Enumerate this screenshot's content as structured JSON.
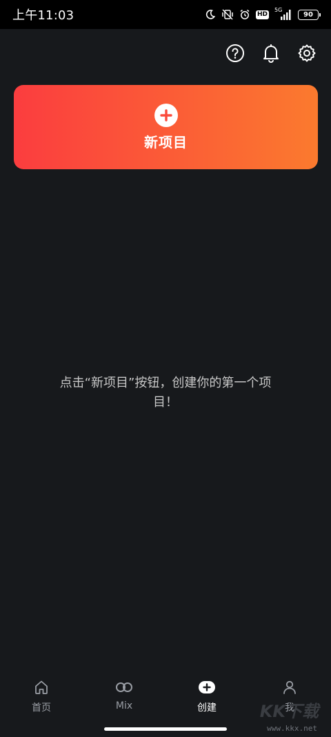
{
  "status_bar": {
    "time": "上午11:03",
    "hd": "HD",
    "network": "5G",
    "battery": "90"
  },
  "top_actions": {
    "icons": [
      "help-icon",
      "bell-icon",
      "gear-icon"
    ]
  },
  "new_project": {
    "label": "新项目",
    "colors": {
      "start": "#fb3d3f",
      "end": "#fb7a2e"
    }
  },
  "empty_state": {
    "text": "点击“新项目”按钮，创建你的第一个项目！"
  },
  "bottom_nav": {
    "items": [
      {
        "label": "首页",
        "icon": "home-icon",
        "active": false
      },
      {
        "label": "Mix",
        "icon": "infinity-icon",
        "active": false
      },
      {
        "label": "创建",
        "icon": "create-plus-icon",
        "active": true
      },
      {
        "label": "我",
        "icon": "person-icon",
        "active": false
      }
    ]
  },
  "watermark": {
    "logo": "KK下载",
    "url": "www.kkx.net"
  },
  "theme": {
    "background": "#17191c",
    "accent": "#fb5e36"
  }
}
